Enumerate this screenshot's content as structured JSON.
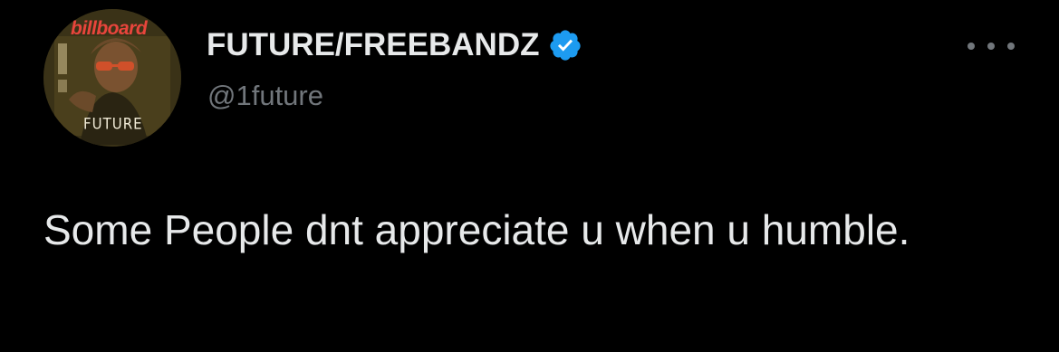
{
  "tweet": {
    "author": {
      "display_name": "FUTURE/FREEBANDZ",
      "handle": "@1future",
      "verified": true,
      "avatar": {
        "brand_text": "billboard",
        "cover_text": "FUTURE"
      }
    },
    "text": "Some People dnt appreciate u when u humble."
  },
  "colors": {
    "background": "#000000",
    "primary_text": "#e7e9ea",
    "secondary_text": "#71767b",
    "verified_badge": "#1d9bf0"
  },
  "icons": {
    "verified": "verified-badge-icon",
    "more": "more-options-icon"
  }
}
